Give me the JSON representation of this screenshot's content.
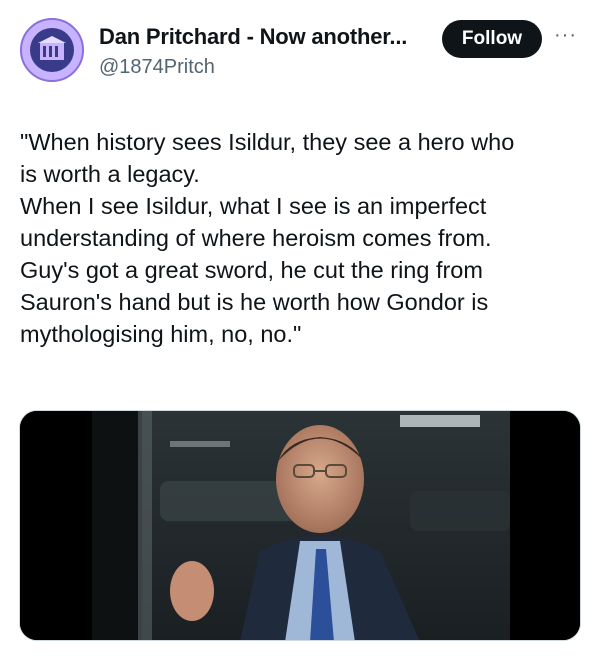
{
  "author": {
    "display_name": "Dan Pritchard - Now another...",
    "handle": "@1874Pritch"
  },
  "actions": {
    "follow_label": "Follow",
    "more_label": "···"
  },
  "tweet": {
    "lines": [
      "\"When history sees Isildur, they see a hero who",
      "is worth a legacy.",
      "When I see Isildur, what I see is an imperfect",
      "understanding of where heroism comes from.",
      "Guy's got a great sword, he cut the ring from",
      "Sauron's hand but is he worth how Gondor is",
      "mythologising him, no, no.\""
    ]
  },
  "colors": {
    "text": "#0f1419",
    "secondary": "#536471",
    "button": "#0f1419",
    "avatar": "#c7b3ff"
  }
}
